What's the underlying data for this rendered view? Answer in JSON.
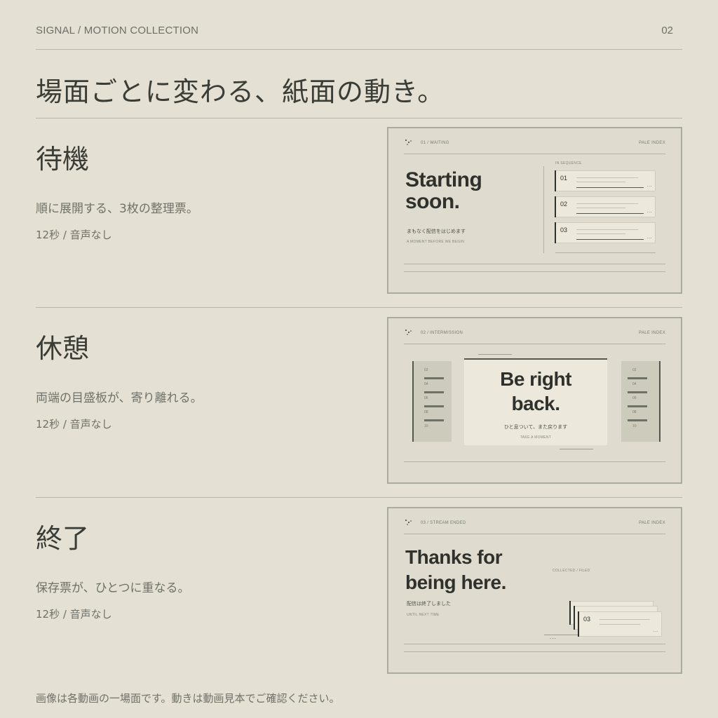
{
  "header": {
    "brand": "SIGNAL / MOTION COLLECTION",
    "page": "02"
  },
  "headline": "場面ごとに変わる、紙面の動き。",
  "sections": [
    {
      "title": "待機",
      "description": "順に展開する、3枚の整理票。",
      "meta": "12秒 / 音声なし",
      "preview": {
        "tag": "01 / WAITING",
        "index": "PALE INDEX",
        "title_line1": "Starting",
        "title_line2": "soon.",
        "subtitle_jp": "まもなく配信をはじめます",
        "subtitle_en": "A MOMENT BEFORE WE BEGIN",
        "sequence_label": "IN SEQUENCE",
        "cards": [
          "01",
          "02",
          "03"
        ],
        "dots": "..."
      }
    },
    {
      "title": "休憩",
      "description": "両端の目盛板が、寄り離れる。",
      "meta": "12秒 / 音声なし",
      "preview": {
        "tag": "02 / INTERMISSION",
        "index": "PALE INDEX",
        "title_line1": "Be right",
        "title_line2": "back.",
        "subtitle_jp": "ひと息ついて、また戻ります",
        "subtitle_en": "TAKE A MOMENT",
        "ruler_left": [
          "02",
          "04",
          "06",
          "08",
          "10"
        ],
        "ruler_right": [
          "02",
          "04",
          "06",
          "08",
          "10"
        ]
      }
    },
    {
      "title": "終了",
      "description": "保存票が、ひとつに重なる。",
      "meta": "12秒 / 音声なし",
      "preview": {
        "tag": "03 / STREAM ENDED",
        "index": "PALE INDEX",
        "title_line1": "Thanks for",
        "title_line2": "being here.",
        "subtitle_jp": "配信は終了しました",
        "subtitle_en": "UNTIL NEXT TIME",
        "stack_label": "COLLECTED / FILED",
        "stack_number": "03",
        "dots": "..."
      }
    }
  ],
  "footnote": "画像は各動画の一場面です。動きは動画見本でご確認ください。",
  "colors": {
    "background": "#e4e0d3",
    "ink": "#3a3d36",
    "muted": "#6f7168",
    "rule": "#b7b6a7",
    "panel_border": "#a9ab9b"
  }
}
